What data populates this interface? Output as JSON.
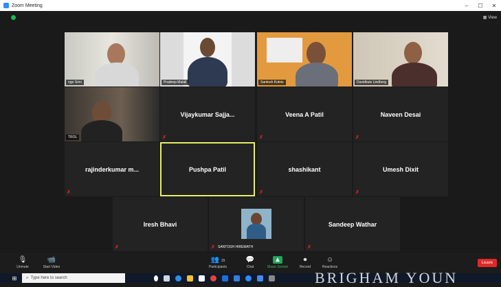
{
  "window": {
    "title": "Zoom Meeting",
    "minimize": "–",
    "restore": "☐",
    "close": "✕",
    "view_label": "View"
  },
  "tiles": [
    {
      "id": "t1",
      "kind": "video",
      "name": "nge Srini"
    },
    {
      "id": "t2",
      "kind": "video",
      "name": "Pradeep Malali"
    },
    {
      "id": "t3",
      "kind": "video",
      "name": "Santosh Kotnis"
    },
    {
      "id": "t4",
      "kind": "video",
      "name": "Davidbuie Lindberg"
    },
    {
      "id": "t5",
      "kind": "video",
      "name": "TROL"
    },
    {
      "id": "t6",
      "kind": "name",
      "name": "Vijaykumar  Sajja..."
    },
    {
      "id": "t7",
      "kind": "name",
      "name": "Veena A Patil"
    },
    {
      "id": "t8",
      "kind": "name",
      "name": "Naveen Desai"
    },
    {
      "id": "t9",
      "kind": "name",
      "name": "rajinderkumar  m..."
    },
    {
      "id": "t10",
      "kind": "name",
      "name": "Pushpa Patil",
      "active": true
    },
    {
      "id": "t11",
      "kind": "name",
      "name": "shashikant"
    },
    {
      "id": "t12",
      "kind": "name",
      "name": "Umesh Dixit"
    },
    {
      "id": "t13",
      "kind": "name",
      "name": "Iresh Bhavi"
    },
    {
      "id": "t14",
      "kind": "avatar",
      "name": "SANTOSH HIREMATH"
    },
    {
      "id": "t15",
      "kind": "name",
      "name": "Sandeep Wathar"
    }
  ],
  "toolbar": {
    "unmute": "Unmute",
    "start_video": "Start Video",
    "participants": "Participants",
    "participants_count": "15",
    "chat": "Chat",
    "share_screen": "Share Screen",
    "record": "Record",
    "reactions": "Reactions",
    "leave": "Leave"
  },
  "taskbar": {
    "search_placeholder": "Type here to search",
    "watermark": "BRIGHAM YOUN"
  },
  "colors": {
    "active_speaker": "#e8f06a",
    "mic_off": "#e02020",
    "share": "#22a55a",
    "leave": "#e02828"
  }
}
